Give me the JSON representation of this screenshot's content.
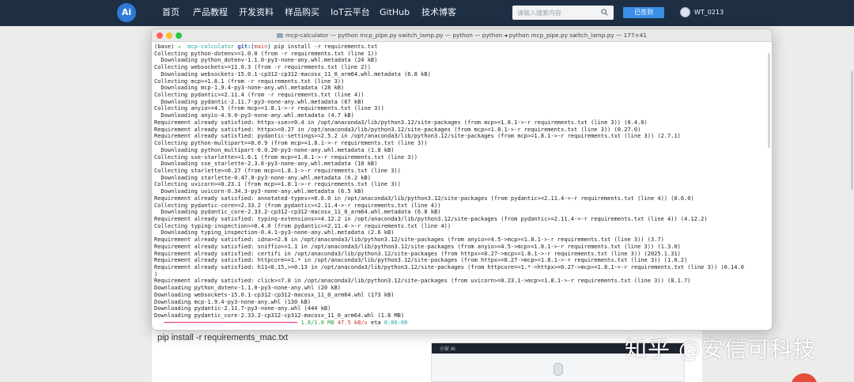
{
  "site": {
    "logo_text": "Ai",
    "nav": [
      "首页",
      "产品教程",
      "开发资料",
      "样品购买",
      "IoT云平台",
      "GitHub",
      "技术博客"
    ],
    "search_placeholder": "请输入搜索内容",
    "signin_label": "已签到",
    "username": "WT_0213"
  },
  "page": {
    "text_line": "pip install -r requirements_mac.txt",
    "thumb_title": "小安 AI",
    "watermark": "知乎 @安信可科技"
  },
  "terminal": {
    "title": "mcp-calculator — python mcp_pipe.py switch_lamp.py — python — python ◂ python mcp_pipe.py switch_lamp.py — 177×41",
    "prompt": {
      "env": "(base)",
      "arrow": "→",
      "dir": "mcp-calculator",
      "git_label": "git:(",
      "branch": "main",
      "git_close": ")",
      "command": "pip install -r requirements.txt"
    },
    "lines": [
      "Collecting python-dotenv>=1.0.0 (from -r requirements.txt (line 1))",
      "  Downloading python_dotenv-1.1.0-py3-none-any.whl.metadata (24 kB)",
      "Collecting websockets>=11.0.3 (from -r requirements.txt (line 2))",
      "  Downloading websockets-15.0.1-cp312-cp312-macosx_11_0_arm64.whl.metadata (6.8 kB)",
      "Collecting mcp>=1.8.1 (from -r requirements.txt (line 3))",
      "  Downloading mcp-1.9.4-py3-none-any.whl.metadata (28 kB)",
      "Collecting pydantic>=2.11.4 (from -r requirements.txt (line 4))",
      "  Downloading pydantic-2.11.7-py3-none-any.whl.metadata (67 kB)",
      "Collecting anyio>=4.5 (from mcp>=1.8.1->-r requirements.txt (line 3))",
      "  Downloading anyio-4.9.0-py3-none-any.whl.metadata (4.7 kB)",
      "Requirement already satisfied: httpx-sse>=0.4 in /opt/anaconda3/lib/python3.12/site-packages (from mcp>=1.8.1->-r requirements.txt (line 3)) (0.4.0)",
      "Requirement already satisfied: httpx>=0.27 in /opt/anaconda3/lib/python3.12/site-packages (from mcp>=1.8.1->-r requirements.txt (line 3)) (0.27.0)",
      "Requirement already satisfied: pydantic-settings>=2.5.2 in /opt/anaconda3/lib/python3.12/site-packages (from mcp>=1.8.1->-r requirements.txt (line 3)) (2.7.1)",
      "Collecting python-multipart>=0.0.9 (from mcp>=1.8.1->-r requirements.txt (line 3))",
      "  Downloading python_multipart-0.0.20-py3-none-any.whl.metadata (1.8 kB)",
      "Collecting sse-starlette>=1.6.1 (from mcp>=1.8.1->-r requirements.txt (line 3))",
      "  Downloading sse_starlette-2.3.6-py3-none-any.whl.metadata (10 kB)",
      "Collecting starlette>=0.27 (from mcp>=1.8.1->-r requirements.txt (line 3))",
      "  Downloading starlette-0.47.0-py3-none-any.whl.metadata (6.2 kB)",
      "Collecting uvicorn>=0.23.1 (from mcp>=1.8.1->-r requirements.txt (line 3))",
      "  Downloading uvicorn-0.34.3-py3-none-any.whl.metadata (6.5 kB)",
      "Requirement already satisfied: annotated-types>=0.6.0 in /opt/anaconda3/lib/python3.12/site-packages (from pydantic>=2.11.4->-r requirements.txt (line 4)) (0.6.0)",
      "Collecting pydantic-core==2.33.2 (from pydantic>=2.11.4->-r requirements.txt (line 4))",
      "  Downloading pydantic_core-2.33.2-cp312-cp312-macosx_11_0_arm64.whl.metadata (6.8 kB)",
      "Requirement already satisfied: typing-extensions>=4.12.2 in /opt/anaconda3/lib/python3.12/site-packages (from pydantic>=2.11.4->-r requirements.txt (line 4)) (4.12.2)",
      "Collecting typing-inspection>=0.4.0 (from pydantic>=2.11.4->-r requirements.txt (line 4))",
      "  Downloading typing_inspection-0.4.1-py3-none-any.whl.metadata (2.6 kB)",
      "Requirement already satisfied: idna>=2.8 in /opt/anaconda3/lib/python3.12/site-packages (from anyio>=4.5->mcp>=1.8.1->-r requirements.txt (line 3)) (3.7)",
      "Requirement already satisfied: sniffio>=1.1 in /opt/anaconda3/lib/python3.12/site-packages (from anyio>=4.5->mcp>=1.8.1->-r requirements.txt (line 3)) (1.3.0)",
      "Requirement already satisfied: certifi in /opt/anaconda3/lib/python3.12/site-packages (from httpx>=0.27->mcp>=1.8.1->-r requirements.txt (line 3)) (2025.1.31)",
      "Requirement already satisfied: httpcore==1.* in /opt/anaconda3/lib/python3.12/site-packages (from httpx>=0.27->mcp>=1.8.1->-r requirements.txt (line 3)) (1.0.2)",
      "Requirement already satisfied: h11<0.15,>=0.13 in /opt/anaconda3/lib/python3.12/site-packages (from httpcore==1.*->httpx>=0.27->mcp>=1.8.1->-r requirements.txt (line 3)) (0.14.0",
      ")",
      "Requirement already satisfied: click>=7.0 in /opt/anaconda3/lib/python3.12/site-packages (from uvicorn>=0.23.1->mcp>=1.8.1->-r requirements.txt (line 3)) (8.1.7)",
      "Downloading python_dotenv-1.1.0-py3-none-any.whl (20 kB)",
      "Downloading websockets-15.0.1-cp312-cp312-macosx_11_0_arm64.whl (173 kB)",
      "Downloading mcp-1.9.4-py3-none-any.whl (130 kB)",
      "Downloading pydantic-2.11.7-py3-none-any.whl (444 kB)",
      "Downloading pydantic_core-2.33.2-cp312-cp312-macosx_11_0_arm64.whl (1.8 MB)"
    ],
    "progress": {
      "bar": "━━━━━━━━━━━━━━━━━━━━━━━━━━━━━━━━━━━━━━━━",
      "size": "1.8/1.8 MB",
      "speed": "47.5 kB/s",
      "eta_label": "eta",
      "eta": "0:00:00"
    }
  },
  "colors": {
    "nav_bg": "#1e2f44",
    "signin_bg": "#3a8ee8",
    "prompt_arrow": "#2ea043",
    "prompt_dir": "#28a3a7",
    "progress_bar": "#e0408a"
  }
}
